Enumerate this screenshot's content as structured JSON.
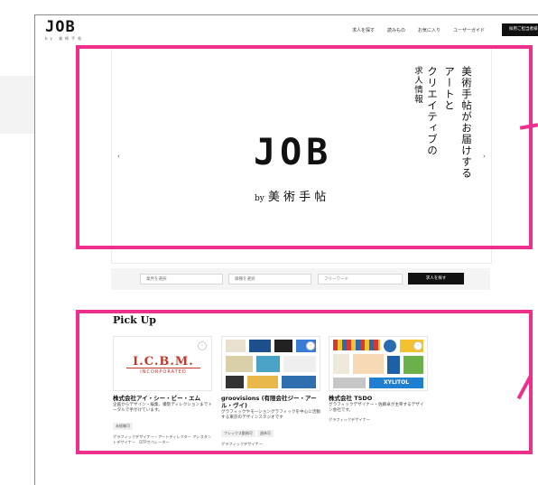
{
  "logo": {
    "main": "JOB",
    "sub": "by 美術手帖"
  },
  "nav": {
    "items": [
      "求人を探す",
      "読みもの",
      "お気に入り",
      "ユーザーガイド"
    ],
    "cta": "採用ご担当者様"
  },
  "hero": {
    "logo": "JOB",
    "by": "by",
    "brand": "美 術 手 帖",
    "copy": [
      "美術手帖がお届けする",
      "アートと",
      "クリエイティブの",
      "求人情報"
    ],
    "prev": "‹",
    "next": "›"
  },
  "search": {
    "category": "業界を選択",
    "job": "職種を選択",
    "keyword": "フリーワード",
    "button": "求人を探す"
  },
  "pickup": {
    "title": "Pick Up",
    "cards": [
      {
        "name": "株式会社アイ・シー・ビー・エム",
        "desc": "企画からデザイン・編集、撮影ディレクションまでトータルで手がけています。",
        "tags": [
          "未経験可"
        ],
        "roles": "グラフィックデザイナー・アートディレクター アシスタントデザイナー　DTPオペレーター",
        "logo_main": "I.C.B.M.",
        "logo_sub": "INCORPORATED"
      },
      {
        "name": "groovisions (有限会社ジー・アール・ヴイ)",
        "desc": "グラフィックやモーショングラフィックを中心に活動する東京のデザインスタジオです",
        "tags": [
          "フレックス勤務可",
          "週休可"
        ],
        "roles": "グラフィックデザイナー"
      },
      {
        "name": "株式会社 TSDO",
        "desc": "グラフィックデザイナー・佐藤卓が主宰するデザイン会社です。",
        "tags": [],
        "roles": "グラフィックデザイナー",
        "art_text": "XYLITOL"
      }
    ]
  },
  "colors": {
    "highlight": "#ee2f8b",
    "accent": "#111111"
  }
}
